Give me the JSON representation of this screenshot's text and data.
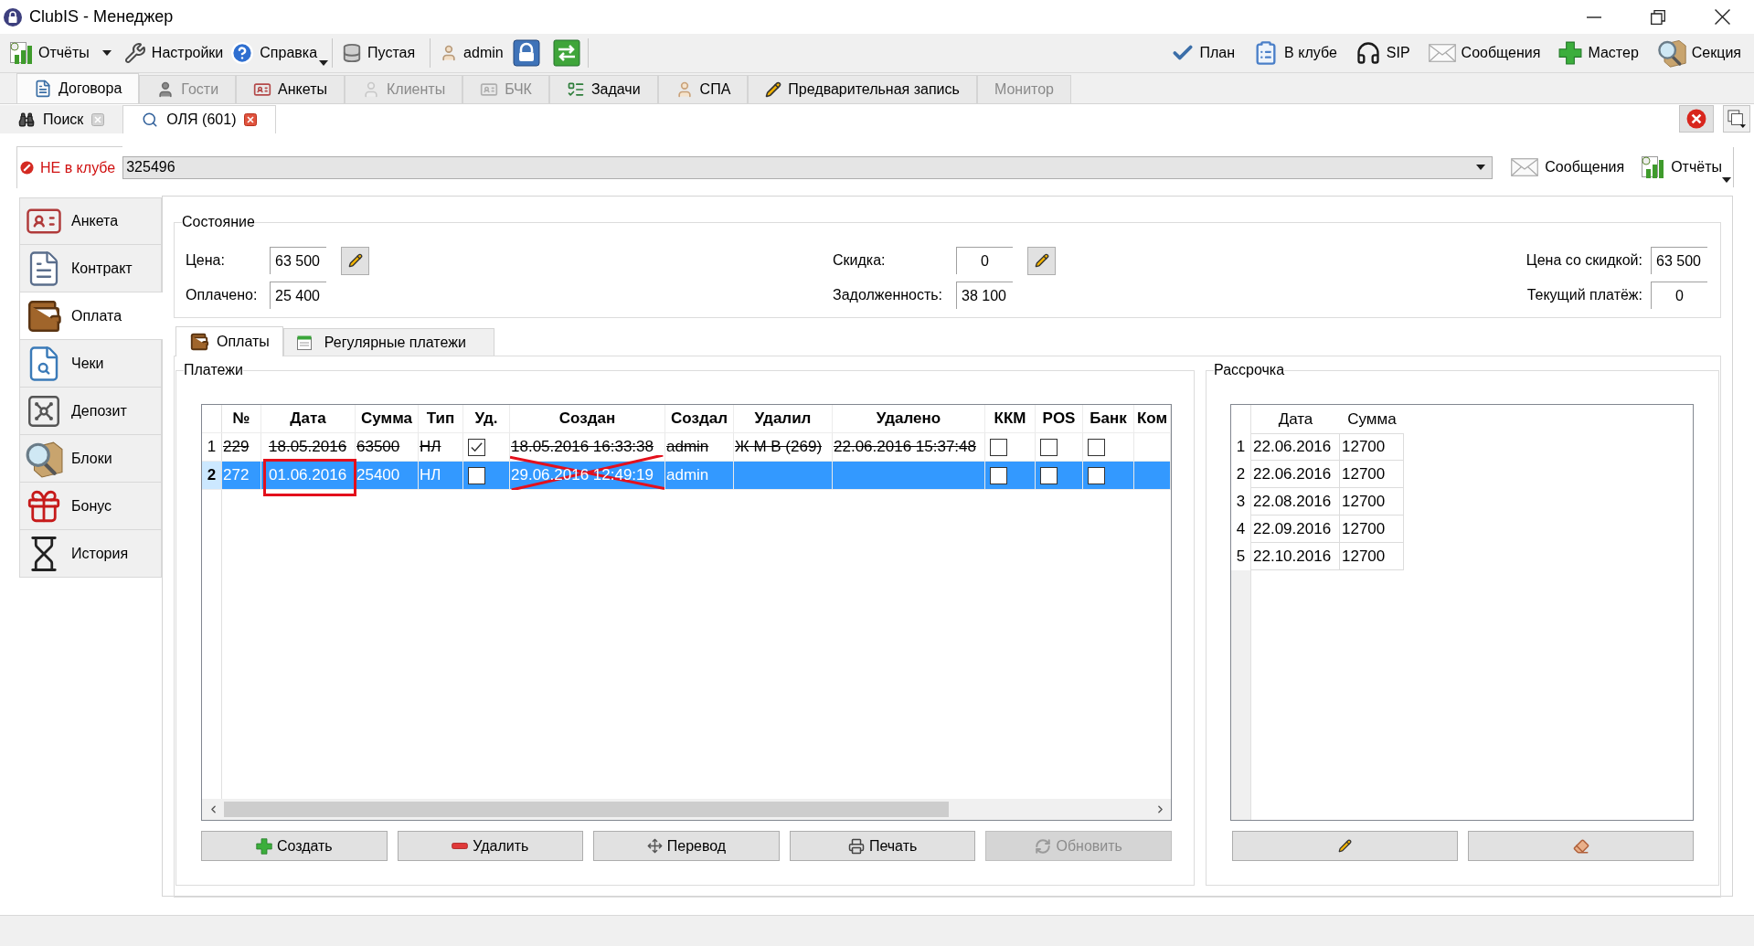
{
  "window": {
    "title": "ClubIS - Менеджер"
  },
  "toolbar": {
    "left": [
      {
        "label": "Отчёты",
        "kind": "split"
      },
      {
        "label": "Настройки",
        "kind": "plain"
      },
      {
        "label": "Справка",
        "kind": "menu"
      },
      {
        "label": "Пустая",
        "kind": "plain"
      },
      {
        "label": "admin",
        "kind": "plain"
      }
    ],
    "right": [
      {
        "label": "План"
      },
      {
        "label": "В клубе"
      },
      {
        "label": "SIP"
      },
      {
        "label": "Сообщения"
      },
      {
        "label": "Мастер"
      },
      {
        "label": "Секция"
      }
    ]
  },
  "main_tabs": [
    {
      "label": "Договора",
      "selected": true,
      "disabled": false
    },
    {
      "label": "Гости",
      "selected": false,
      "disabled": true
    },
    {
      "label": "Анкеты",
      "selected": false,
      "disabled": false
    },
    {
      "label": "Клиенты",
      "selected": false,
      "disabled": true
    },
    {
      "label": "БЧК",
      "selected": false,
      "disabled": true
    },
    {
      "label": "Задачи",
      "selected": false,
      "disabled": false
    },
    {
      "label": "СПА",
      "selected": false,
      "disabled": false
    },
    {
      "label": "Предварительная запись",
      "selected": false,
      "disabled": false
    },
    {
      "label": "Монитор",
      "selected": false,
      "disabled": true
    }
  ],
  "document_tabs": [
    {
      "label": "Поиск",
      "selected": false
    },
    {
      "label": "ОЛЯ (601)",
      "selected": true
    }
  ],
  "client": {
    "status": "НЕ в клубе",
    "card_number": "325496",
    "buttons": [
      {
        "label": "Сообщения",
        "kind": "plain"
      },
      {
        "label": "Отчёты",
        "kind": "menu"
      }
    ]
  },
  "sidebar": {
    "items": [
      {
        "label": "Анкета",
        "selected": false
      },
      {
        "label": "Контракт",
        "selected": false
      },
      {
        "label": "Оплата",
        "selected": true
      },
      {
        "label": "Чеки",
        "selected": false
      },
      {
        "label": "Депозит",
        "selected": false
      },
      {
        "label": "Блоки",
        "selected": false
      },
      {
        "label": "Бонус",
        "selected": false
      },
      {
        "label": "История",
        "selected": false
      }
    ]
  },
  "state": {
    "title": "Состояние",
    "fields": [
      {
        "label": "Цена:",
        "value": "63 500",
        "editable": true
      },
      {
        "label": "Оплачено:",
        "value": "25 400",
        "editable": false
      },
      {
        "label": "Скидка:",
        "value": "0",
        "editable": true
      },
      {
        "label": "Задолженность:",
        "value": "38 100",
        "editable": false
      },
      {
        "label": "Цена со скидкой:",
        "value": "63 500",
        "editable": false
      },
      {
        "label": "Текущий платёж:",
        "value": "0",
        "editable": false
      }
    ]
  },
  "payment_tabs": [
    {
      "label": "Оплаты",
      "selected": true
    },
    {
      "label": "Регулярные платежи",
      "selected": false
    }
  ],
  "payments": {
    "title": "Платежи",
    "columns": [
      {
        "label": "№"
      },
      {
        "label": "Дата"
      },
      {
        "label": "Сумма"
      },
      {
        "label": "Тип"
      },
      {
        "label": "Уд."
      },
      {
        "label": "Создан"
      },
      {
        "label": "Создал"
      },
      {
        "label": "Удалил"
      },
      {
        "label": "Удалено"
      },
      {
        "label": "ККМ"
      },
      {
        "label": "POS"
      },
      {
        "label": "Банк"
      },
      {
        "label": "Ком"
      }
    ],
    "rows": [
      {
        "header": "1",
        "selected": false,
        "struck": true,
        "date_outlined": false,
        "created_crossed": false,
        "number": "229",
        "date": "18.05.2016",
        "amount": "63500",
        "type": "НЛ",
        "removed": true,
        "created": "18.05.2016 16:33:38",
        "created_by": "admin",
        "deleted_by": "Ж М В (269)",
        "deleted_at": "22.06.2016 15:37:48",
        "kkm": false,
        "pos": false,
        "bank": false
      },
      {
        "header": "2",
        "selected": true,
        "struck": false,
        "date_outlined": true,
        "created_crossed": true,
        "number": "272",
        "date": "01.06.2016",
        "amount": "25400",
        "type": "НЛ",
        "removed": false,
        "created": "29.06.2016 12:49:19",
        "created_by": "admin",
        "kkm": false,
        "pos": false,
        "bank": false
      }
    ],
    "buttons": [
      {
        "label": "Создать",
        "disabled": false
      },
      {
        "label": "Удалить",
        "disabled": false
      },
      {
        "label": "Перевод",
        "disabled": false
      },
      {
        "label": "Печать",
        "disabled": false
      },
      {
        "label": "Обновить",
        "disabled": true
      }
    ]
  },
  "installments": {
    "title": "Рассрочка",
    "columns": [
      {
        "label": "Дата"
      },
      {
        "label": "Сумма"
      }
    ],
    "rows": [
      {
        "header": "1",
        "date": "22.06.2016",
        "amount": "12700"
      },
      {
        "header": "2",
        "date": "22.06.2016",
        "amount": "12700"
      },
      {
        "header": "3",
        "date": "22.08.2016",
        "amount": "12700"
      },
      {
        "header": "4",
        "date": "22.09.2016",
        "amount": "12700"
      },
      {
        "header": "5",
        "date": "22.10.2016",
        "amount": "12700"
      }
    ]
  }
}
